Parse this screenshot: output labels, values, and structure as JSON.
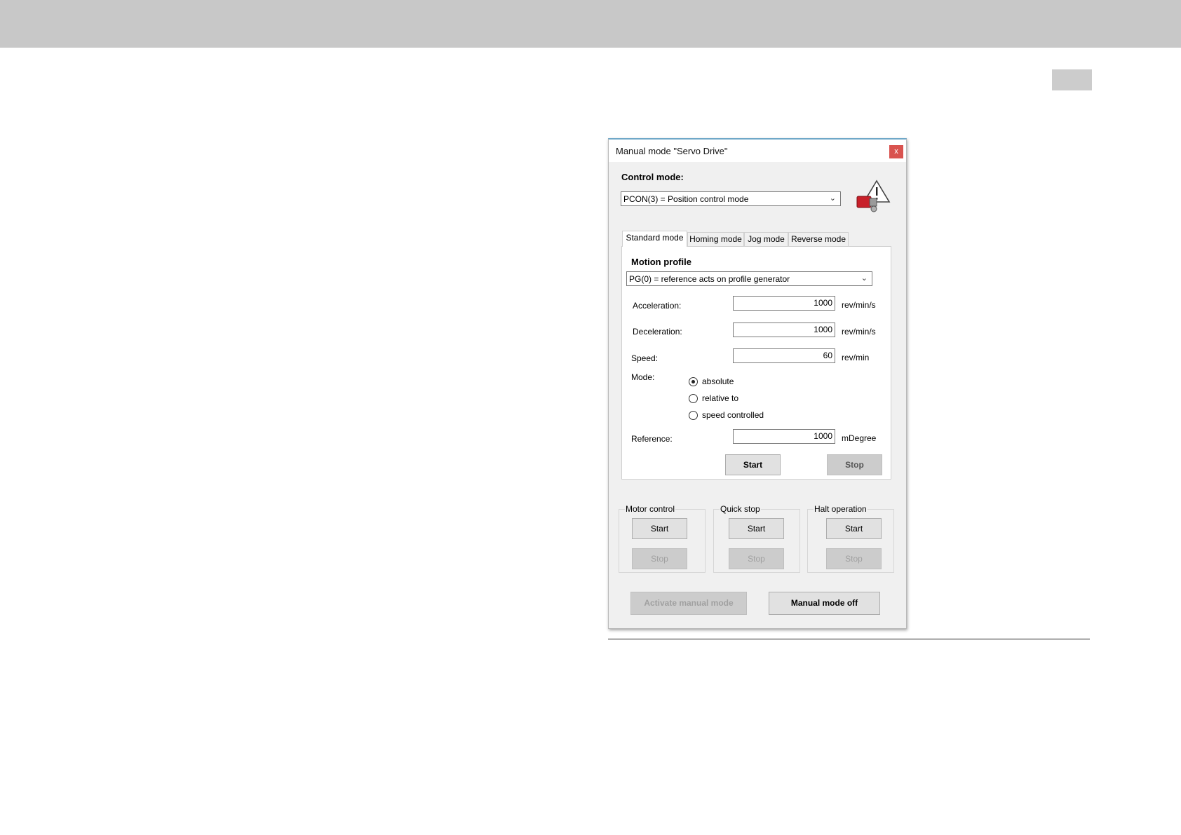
{
  "window": {
    "title": "Manual mode \"Servo Drive\"",
    "close_label": "x"
  },
  "control_mode": {
    "label": "Control mode:",
    "selected": "PCON(3) = Position control mode"
  },
  "tabs": [
    {
      "label": "Standard mode",
      "active": true
    },
    {
      "label": "Homing mode",
      "active": false
    },
    {
      "label": "Jog mode",
      "active": false
    },
    {
      "label": "Reverse mode",
      "active": false
    }
  ],
  "standard": {
    "motion_profile_label": "Motion profile",
    "motion_profile_selected": "PG(0) = reference acts on profile generator",
    "acceleration": {
      "label": "Acceleration:",
      "value": "1000",
      "unit": "rev/min/s"
    },
    "deceleration": {
      "label": "Deceleration:",
      "value": "1000",
      "unit": "rev/min/s"
    },
    "speed": {
      "label": "Speed:",
      "value": "60",
      "unit": "rev/min"
    },
    "mode": {
      "label": "Mode:",
      "options": [
        {
          "label": "absolute",
          "selected": true
        },
        {
          "label": "relative to",
          "selected": false
        },
        {
          "label": "speed controlled",
          "selected": false
        }
      ]
    },
    "reference": {
      "label": "Reference:",
      "value": "1000",
      "unit": "mDegree"
    },
    "start_label": "Start",
    "stop_label": "Stop"
  },
  "groups": {
    "motor_control": {
      "label": "Motor control",
      "start": "Start",
      "stop": "Stop"
    },
    "quick_stop": {
      "label": "Quick stop",
      "start": "Start",
      "stop": "Stop"
    },
    "halt_operation": {
      "label": "Halt operation",
      "start": "Start",
      "stop": "Stop"
    }
  },
  "footer": {
    "activate_label": "Activate manual mode",
    "off_label": "Manual mode off"
  },
  "colors": {
    "close_button": "#d9534f",
    "page_header": "#c8c8c8"
  },
  "icons": {
    "close": "close-icon",
    "warning": "warning-motor-icon",
    "dropdown": "chevron-down-icon"
  }
}
